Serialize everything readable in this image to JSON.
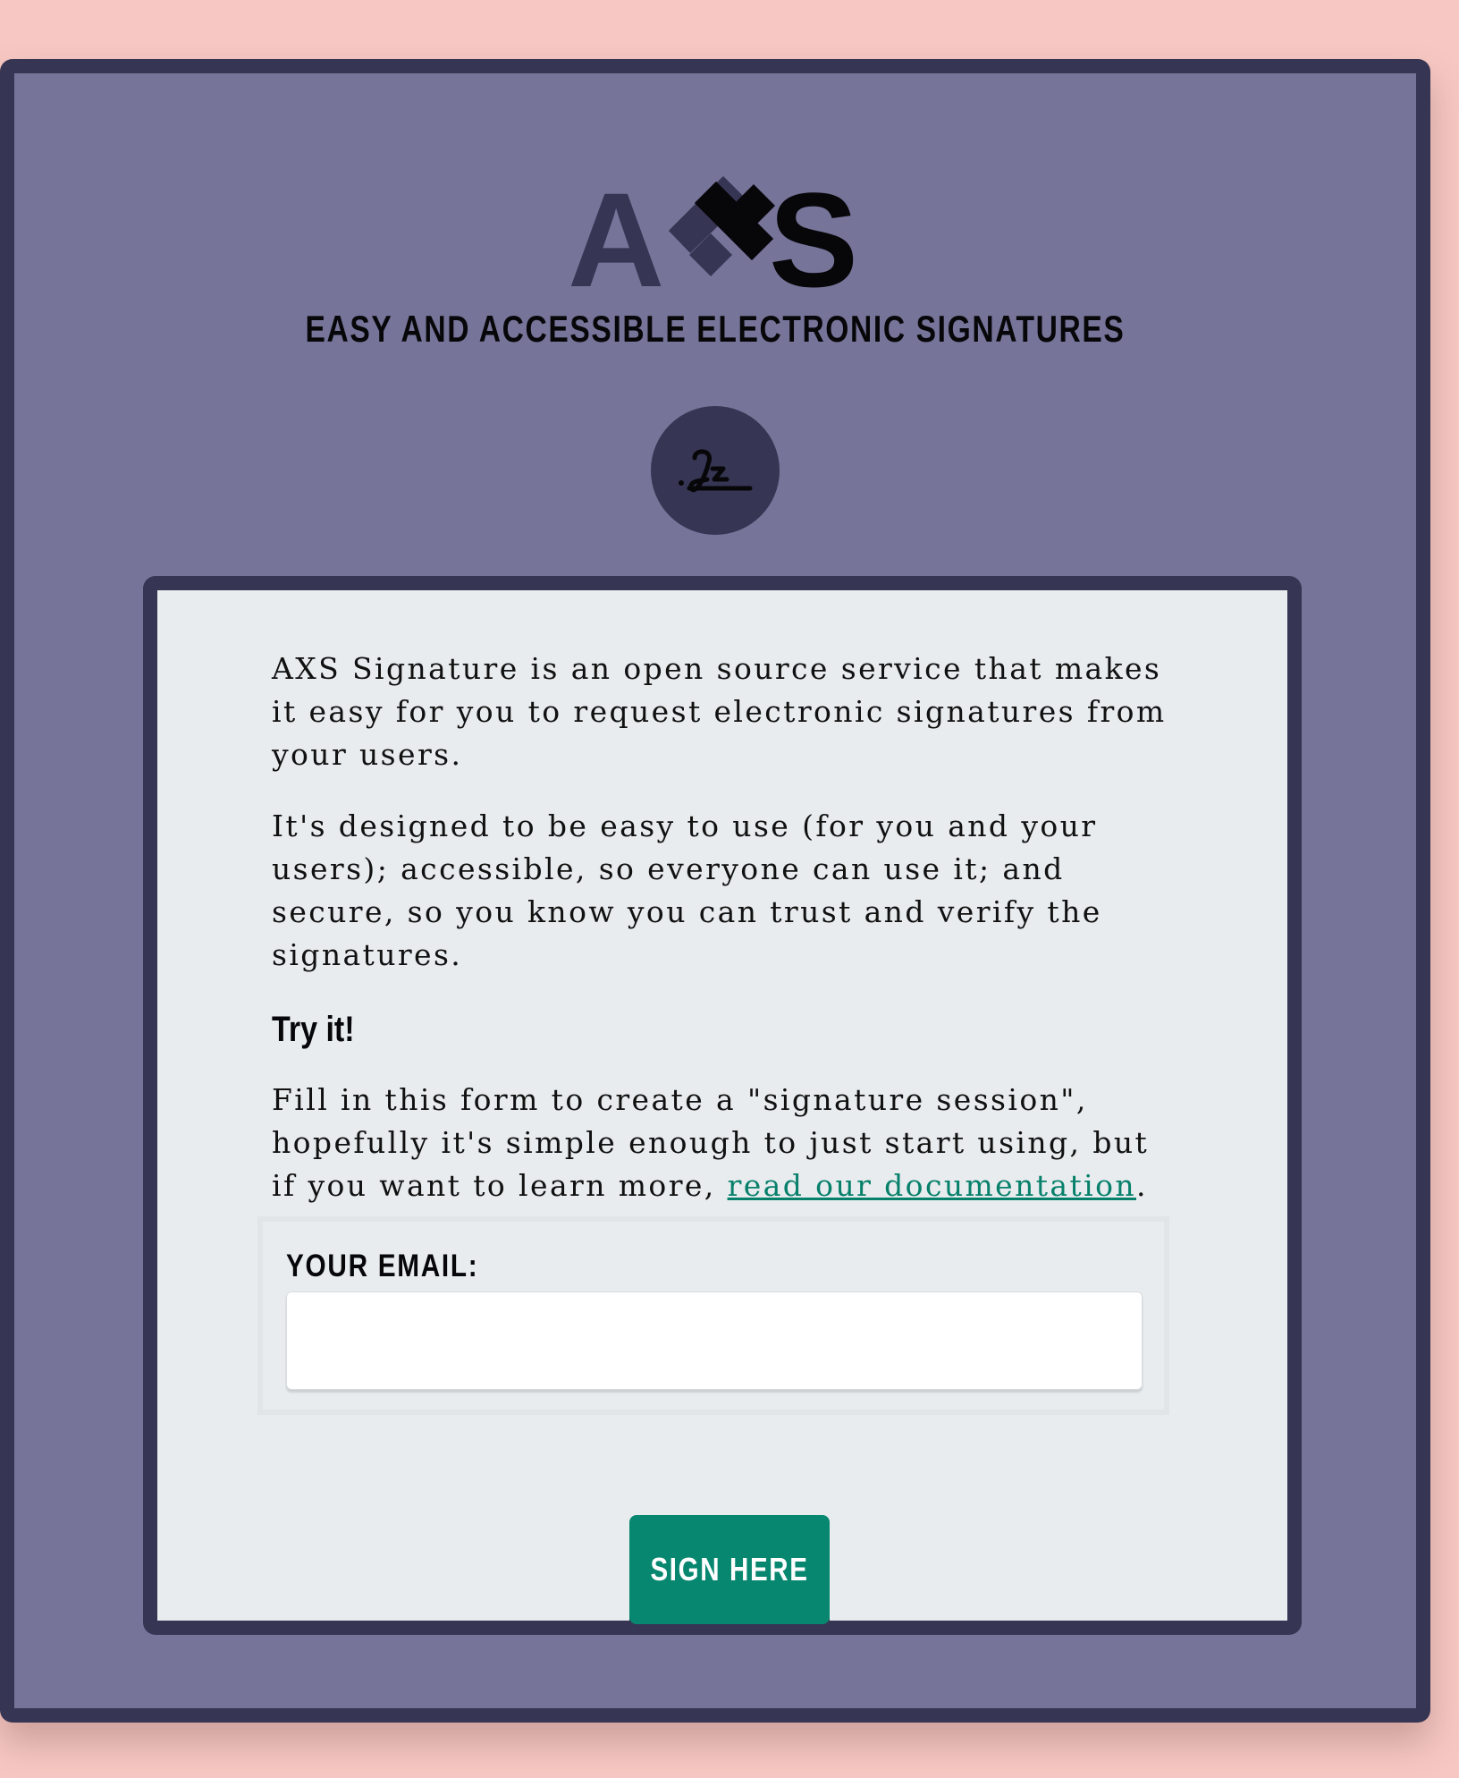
{
  "logo": {
    "text": "AXS",
    "letters": {
      "a": "A",
      "x": "X",
      "s": "S"
    }
  },
  "header": {
    "tagline": "EASY AND ACCESSIBLE ELECTRONIC SIGNATURES"
  },
  "icons": {
    "signature": "signature-icon"
  },
  "intro": {
    "paragraph1": "AXS Signature is an open source service that makes it easy for you to request electronic signatures from your users.",
    "paragraph2": "It's designed to be easy to use (for you and your users); accessible, so everyone can use it; and secure, so you know you can trust and verify the signatures."
  },
  "try_section": {
    "heading": "Try it!",
    "text_before_link": "Fill in this form to create a \"signature session\", hopefully it's simple enough to just start using, but if you want to learn more, ",
    "link_text": "read our documentation",
    "text_after_link": "."
  },
  "form": {
    "email_label": "YOUR EMAIL:",
    "email_value": "",
    "email_placeholder": "",
    "submit_label": "SIGN HERE"
  },
  "colors": {
    "page_background": "#f7c8c3",
    "frame_background": "#767499",
    "frame_border": "#363553",
    "card_background": "#e8ecee",
    "accent_green": "#07876f",
    "link_green": "#07806b"
  }
}
